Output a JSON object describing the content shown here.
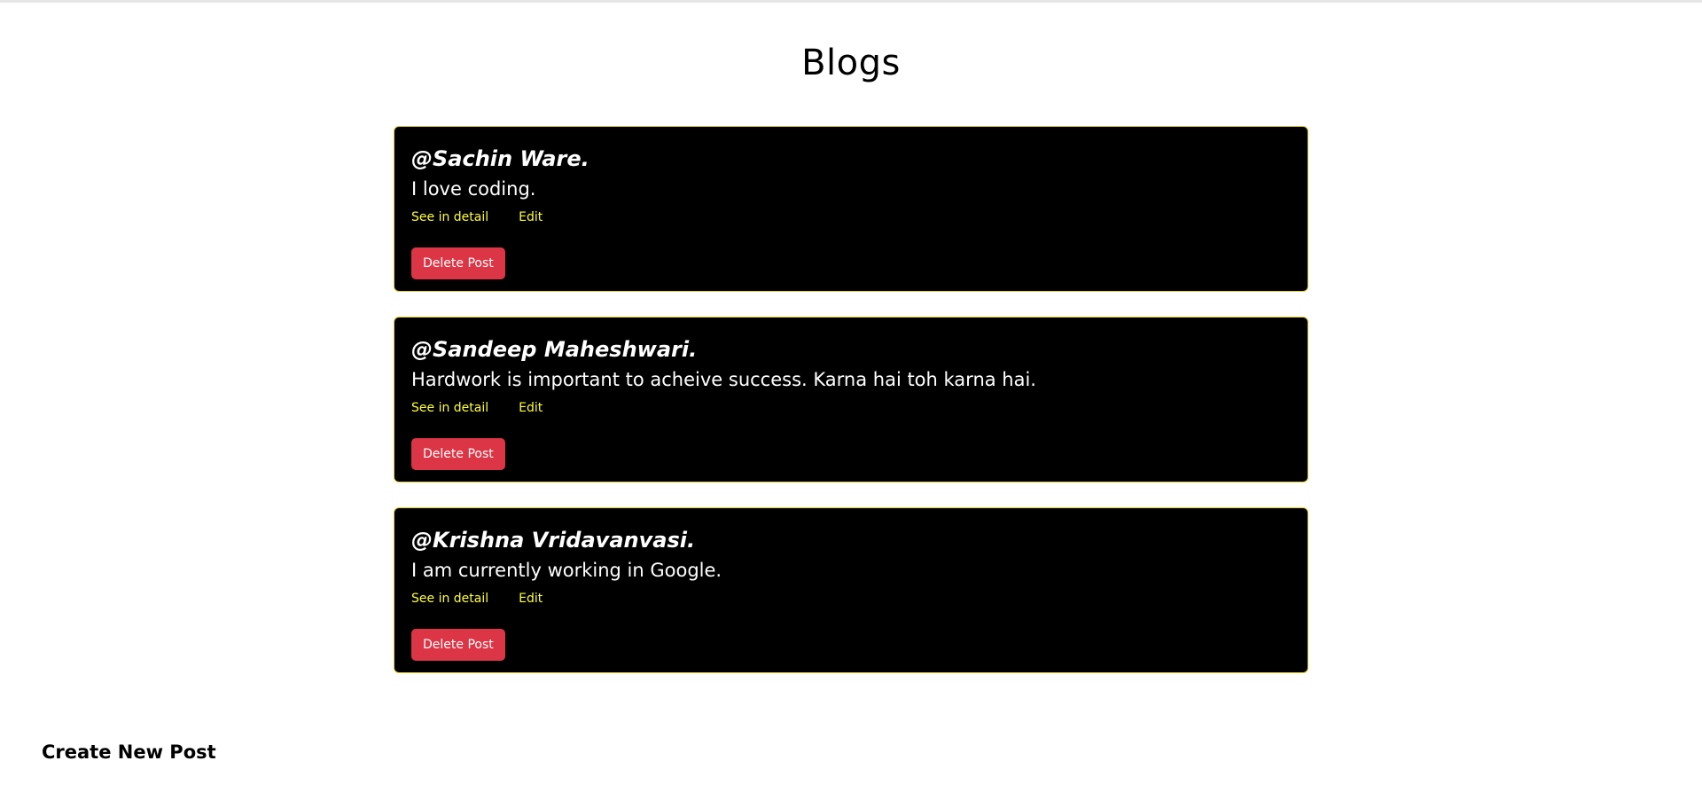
{
  "page": {
    "title": "Blogs"
  },
  "posts": [
    {
      "author": "@Sachin Ware.",
      "body": "I love coding.",
      "detail_link": "See in detail",
      "edit_link": "Edit",
      "delete_label": "Delete Post"
    },
    {
      "author": "@Sandeep Maheshwari.",
      "body": "Hardwork is important to acheive success. Karna hai toh karna hai.",
      "detail_link": "See in detail",
      "edit_link": "Edit",
      "delete_label": "Delete Post"
    },
    {
      "author": "@Krishna Vridavanvasi.",
      "body": "I am currently working in Google.",
      "detail_link": "See in detail",
      "edit_link": "Edit",
      "delete_label": "Delete Post"
    }
  ],
  "footer": {
    "create_link": "Create New Post"
  },
  "colors": {
    "card_background": "#000000",
    "card_border": "#e6cf2a",
    "link": "#ffff33",
    "delete_button": "#dc3545"
  }
}
